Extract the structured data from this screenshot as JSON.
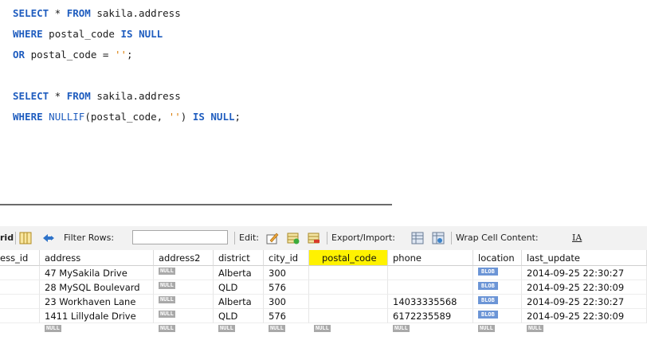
{
  "editor": {
    "lines": [
      {
        "parts": [
          "SELECT",
          " * ",
          "FROM",
          " sakila.address"
        ]
      },
      {
        "parts": [
          "WHERE",
          " postal_code ",
          "IS",
          " ",
          "NULL"
        ]
      },
      {
        "parts": [
          "OR",
          " postal_code = ",
          "''",
          ";"
        ]
      },
      {
        "parts": []
      },
      {
        "parts": [
          "SELECT",
          " * ",
          "FROM",
          " sakila.address"
        ]
      },
      {
        "parts": [
          "WHERE",
          " ",
          "NULLIF",
          "(postal_code, ",
          "''",
          ") ",
          "IS",
          " ",
          "NULL",
          ";"
        ]
      }
    ]
  },
  "toolbar": {
    "grid_label": "rid",
    "filter_label": "Filter Rows:",
    "filter_value": "",
    "edit_label": "Edit:",
    "export_label": "Export/Import:",
    "wrap_label": "Wrap Cell Content:",
    "wrap_icon_glyph": "IA"
  },
  "grid": {
    "columns": [
      "ess_id",
      "address",
      "address2",
      "district",
      "city_id",
      "postal_code",
      "phone",
      "location",
      "last_update"
    ],
    "rows": [
      {
        "address": "47 MySakila Drive",
        "address2": "NULL",
        "district": "Alberta",
        "city_id": "300",
        "postal_code": "",
        "phone": "",
        "location": "BLOB",
        "last_update": "2014-09-25 22:30:27"
      },
      {
        "address": "28 MySQL Boulevard",
        "address2": "NULL",
        "district": "QLD",
        "city_id": "576",
        "postal_code": "",
        "phone": "",
        "location": "BLOB",
        "last_update": "2014-09-25 22:30:09"
      },
      {
        "address": "23 Workhaven Lane",
        "address2": "NULL",
        "district": "Alberta",
        "city_id": "300",
        "postal_code": "",
        "phone": "14033335568",
        "location": "BLOB",
        "last_update": "2014-09-25 22:30:27"
      },
      {
        "address": "1411 Lillydale Drive",
        "address2": "NULL",
        "district": "QLD",
        "city_id": "576",
        "postal_code": "",
        "phone": "6172235589",
        "location": "BLOB",
        "last_update": "2014-09-25 22:30:09"
      }
    ],
    "new_row_value": "NULL"
  },
  "colors": {
    "keyword": "#1f5dbf",
    "string": "#d97a00",
    "highlight": "#fff200",
    "null_badge": "#a9a9a9",
    "blob_badge": "#6c95d6"
  }
}
